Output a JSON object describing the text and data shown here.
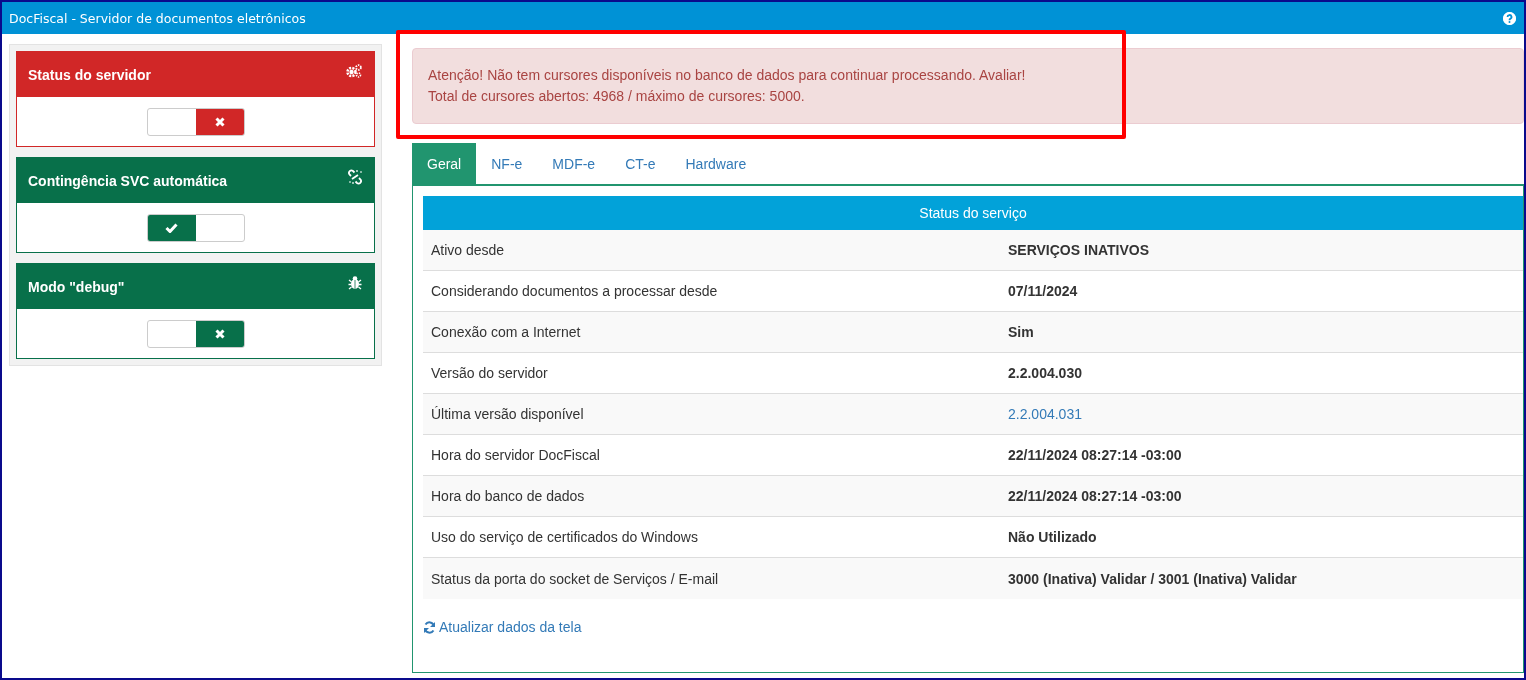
{
  "window": {
    "title": "DocFiscal - Servidor de documentos eletrônicos"
  },
  "panels": [
    {
      "title": "Status do servidor",
      "color": "#d12727",
      "kind": "server",
      "on": false
    },
    {
      "title": "Contingência SVC automática",
      "color": "#08704a",
      "kind": "contingency",
      "on": true
    },
    {
      "title": "Modo \"debug\"",
      "color": "#08704a",
      "kind": "debug",
      "on": false
    }
  ],
  "alert": {
    "lines": [
      "Atenção! Não tem cursores disponíveis no banco de dados para continuar processando. Avaliar!",
      "Total de cursores abertos: 4968 / máximo de cursores: 5000."
    ],
    "highlighted": true
  },
  "tabs": [
    {
      "label": "Geral",
      "selected": true
    },
    {
      "label": "NF-e",
      "selected": false
    },
    {
      "label": "MDF-e",
      "selected": false
    },
    {
      "label": "CT-e",
      "selected": false
    },
    {
      "label": "Hardware",
      "selected": false
    }
  ],
  "table": {
    "title": "Status do serviço",
    "rows": [
      {
        "label": "Ativo desde",
        "value": "SERVIÇOS INATIVOS",
        "kind": "text"
      },
      {
        "label": "Considerando documentos a processar desde",
        "value": "07/11/2024",
        "kind": "text"
      },
      {
        "label": "Conexão com a Internet",
        "value": "Sim",
        "kind": "text"
      },
      {
        "label": "Versão do servidor",
        "value": "2.2.004.030",
        "kind": "text"
      },
      {
        "label": "Última versão disponível",
        "value": "2.2.004.031",
        "kind": "link"
      },
      {
        "label": "Hora do servidor DocFiscal",
        "value": "22/11/2024 08:27:14 -03:00",
        "kind": "text"
      },
      {
        "label": "Hora do banco de dados",
        "value": "22/11/2024 08:27:14 -03:00",
        "kind": "text"
      },
      {
        "label": "Uso do serviço de certificados do Windows",
        "value": "Não Utilizado",
        "kind": "text"
      },
      {
        "label": "Status da porta do socket de Serviços / E-mail",
        "value": "3000 (Inativa) Validar / 3001 (Inativa) Validar",
        "kind": "text"
      }
    ]
  },
  "refresh_link": "Atualizar dados da tela"
}
